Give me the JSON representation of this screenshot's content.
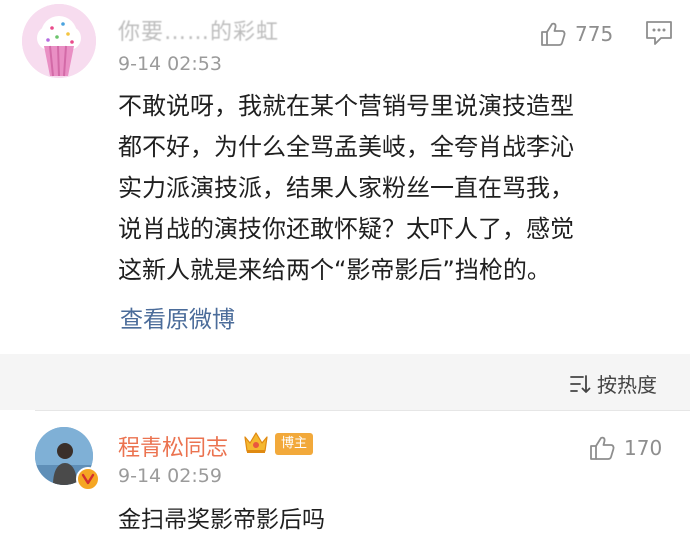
{
  "comment1": {
    "username": "你要……的彩虹",
    "time": "9-14 02:53",
    "like_count": "775",
    "body_lines": [
      "不敢说呀，我就在某个营销号里说演技造型",
      "都不好，为什么全骂孟美岐，全夸肖战李沁",
      "实力派演技派，结果人家粉丝一直在骂我，",
      "说肖战的演技你还敢怀疑？太吓人了，感觉",
      "这新人就是来给两个“影帝影后”挡枪的。"
    ],
    "view_original": "查看原微博",
    "icons": [
      "thumbs-up-icon",
      "reply-icon"
    ]
  },
  "sort": {
    "label": "按热度",
    "icon": "sort-icon"
  },
  "comment2": {
    "username": "程青松同志",
    "badge": "博主",
    "time": "9-14 02:59",
    "like_count": "170",
    "body": "金扫帚奖影帝影后吗",
    "icons": [
      "crown-icon",
      "verified-badge-icon",
      "thumbs-up-icon"
    ]
  },
  "colors": {
    "link": "#4b6c9a",
    "username_highlight": "#eb7350",
    "badge_bg": "#f2a93b",
    "meta_gray": "#9b9b9b",
    "band_bg": "#f5f5f5"
  }
}
